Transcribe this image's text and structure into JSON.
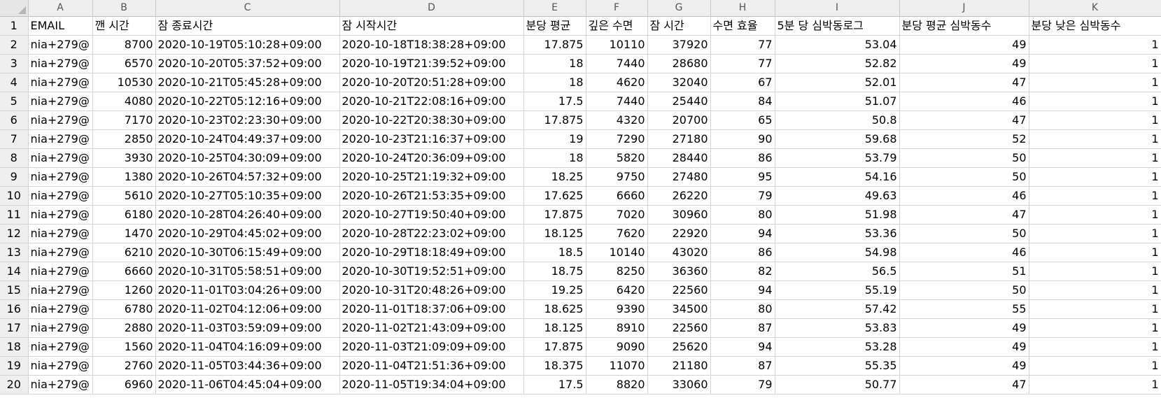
{
  "column_letters": [
    "A",
    "B",
    "C",
    "D",
    "E",
    "F",
    "G",
    "H",
    "I",
    "J",
    "K"
  ],
  "row_numbers": [
    "1",
    "2",
    "3",
    "4",
    "5",
    "6",
    "7",
    "8",
    "9",
    "10",
    "11",
    "12",
    "13",
    "14",
    "15",
    "16",
    "17",
    "18",
    "19",
    "20"
  ],
  "headers": [
    "EMAIL",
    "깬 시간",
    "잠 종료시간",
    "잠 시작시간",
    "분당 평균",
    "깊은 수면",
    "잠 시간",
    "수면 효율",
    "5분 당 심박동로그",
    "분당 평균 심박동수",
    "분당 낮은 심박동수"
  ],
  "rows": [
    [
      "nia+279@",
      "8700",
      "2020-10-19T05:10:28+09:00",
      "2020-10-18T18:38:28+09:00",
      "17.875",
      "10110",
      "37920",
      "77",
      "53.04",
      "49",
      "1"
    ],
    [
      "nia+279@",
      "6570",
      "2020-10-20T05:37:52+09:00",
      "2020-10-19T21:39:52+09:00",
      "18",
      "7440",
      "28680",
      "77",
      "52.82",
      "49",
      "1"
    ],
    [
      "nia+279@",
      "10530",
      "2020-10-21T05:45:28+09:00",
      "2020-10-20T20:51:28+09:00",
      "18",
      "4620",
      "32040",
      "67",
      "52.01",
      "47",
      "1"
    ],
    [
      "nia+279@",
      "4080",
      "2020-10-22T05:12:16+09:00",
      "2020-10-21T22:08:16+09:00",
      "17.5",
      "7440",
      "25440",
      "84",
      "51.07",
      "46",
      "1"
    ],
    [
      "nia+279@",
      "7170",
      "2020-10-23T02:23:30+09:00",
      "2020-10-22T20:38:30+09:00",
      "17.875",
      "4320",
      "20700",
      "65",
      "50.8",
      "47",
      "1"
    ],
    [
      "nia+279@",
      "2850",
      "2020-10-24T04:49:37+09:00",
      "2020-10-23T21:16:37+09:00",
      "19",
      "7290",
      "27180",
      "90",
      "59.68",
      "52",
      "1"
    ],
    [
      "nia+279@",
      "3930",
      "2020-10-25T04:30:09+09:00",
      "2020-10-24T20:36:09+09:00",
      "18",
      "5820",
      "28440",
      "86",
      "53.79",
      "50",
      "1"
    ],
    [
      "nia+279@",
      "1380",
      "2020-10-26T04:57:32+09:00",
      "2020-10-25T21:19:32+09:00",
      "18.25",
      "9750",
      "27480",
      "95",
      "54.16",
      "50",
      "1"
    ],
    [
      "nia+279@",
      "5610",
      "2020-10-27T05:10:35+09:00",
      "2020-10-26T21:53:35+09:00",
      "17.625",
      "6660",
      "26220",
      "79",
      "49.63",
      "46",
      "1"
    ],
    [
      "nia+279@",
      "6180",
      "2020-10-28T04:26:40+09:00",
      "2020-10-27T19:50:40+09:00",
      "17.875",
      "7020",
      "30960",
      "80",
      "51.98",
      "47",
      "1"
    ],
    [
      "nia+279@",
      "1470",
      "2020-10-29T04:45:02+09:00",
      "2020-10-28T22:23:02+09:00",
      "18.125",
      "7620",
      "22920",
      "94",
      "53.36",
      "50",
      "1"
    ],
    [
      "nia+279@",
      "6210",
      "2020-10-30T06:15:49+09:00",
      "2020-10-29T18:18:49+09:00",
      "18.5",
      "10140",
      "43020",
      "86",
      "54.98",
      "46",
      "1"
    ],
    [
      "nia+279@",
      "6660",
      "2020-10-31T05:58:51+09:00",
      "2020-10-30T19:52:51+09:00",
      "18.75",
      "8250",
      "36360",
      "82",
      "56.5",
      "51",
      "1"
    ],
    [
      "nia+279@",
      "1260",
      "2020-11-01T03:04:26+09:00",
      "2020-10-31T20:48:26+09:00",
      "19.25",
      "6420",
      "22560",
      "94",
      "55.19",
      "50",
      "1"
    ],
    [
      "nia+279@",
      "6780",
      "2020-11-02T04:12:06+09:00",
      "2020-11-01T18:37:06+09:00",
      "18.625",
      "9390",
      "34500",
      "80",
      "57.42",
      "55",
      "1"
    ],
    [
      "nia+279@",
      "2880",
      "2020-11-03T03:59:09+09:00",
      "2020-11-02T21:43:09+09:00",
      "18.125",
      "8910",
      "22560",
      "87",
      "53.83",
      "49",
      "1"
    ],
    [
      "nia+279@",
      "1560",
      "2020-11-04T04:16:09+09:00",
      "2020-11-03T21:09:09+09:00",
      "17.875",
      "9090",
      "25620",
      "94",
      "53.28",
      "49",
      "1"
    ],
    [
      "nia+279@",
      "2760",
      "2020-11-05T03:44:36+09:00",
      "2020-11-04T21:51:36+09:00",
      "18.375",
      "11070",
      "21180",
      "87",
      "55.35",
      "49",
      "1"
    ],
    [
      "nia+279@",
      "6960",
      "2020-11-06T04:45:04+09:00",
      "2020-11-05T19:34:04+09:00",
      "17.5",
      "8820",
      "33060",
      "79",
      "50.77",
      "47",
      "1"
    ]
  ]
}
